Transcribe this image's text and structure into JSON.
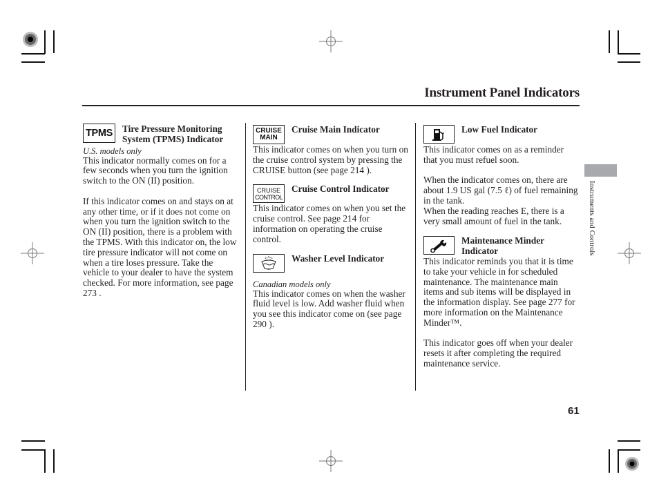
{
  "page": {
    "title": "Instrument Panel Indicators",
    "side_tab_label": "Instruments and Controls",
    "page_number": "61"
  },
  "columns": [
    {
      "sections": [
        {
          "icon": "tpms-icon",
          "icon_text": "TPMS",
          "heading": "Tire Pressure Monitoring System (TPMS) Indicator",
          "note": "U.S. models only",
          "paragraphs": [
            "This indicator normally comes on for a few seconds when you turn the ignition switch to the ON (II) position.",
            "If this indicator comes on and stays on at any other time, or if it does not come on when you turn the ignition switch to the ON (II) position, there is a problem with the TPMS. With this indicator on, the low tire pressure indicator will not come on when a tire loses pressure. Take the vehicle to your dealer to have the system checked. For more information, see page 273 ."
          ]
        }
      ]
    },
    {
      "sections": [
        {
          "icon": "cruise-main-icon",
          "icon_text_line1": "CRUISE",
          "icon_text_line2": "MAIN",
          "heading": "Cruise Main Indicator",
          "paragraphs": [
            "This indicator comes on when you turn on the cruise control system by pressing the CRUISE button (see page 214 )."
          ]
        },
        {
          "icon": "cruise-control-icon",
          "icon_text_line1": "CRUISE",
          "icon_text_line2": "CONTROL",
          "heading": "Cruise Control Indicator",
          "paragraphs": [
            "This indicator comes on when you set the cruise control. See page  214 for information on operating the cruise control."
          ]
        },
        {
          "icon": "washer-fluid-icon",
          "heading": "Washer Level Indicator",
          "note": "Canadian models only",
          "paragraphs": [
            "This indicator comes on when the washer fluid level is low. Add washer fluid when you see this indicator come on (see page 290 )."
          ]
        }
      ]
    },
    {
      "sections": [
        {
          "icon": "fuel-pump-icon",
          "heading": "Low Fuel Indicator",
          "paragraphs": [
            "This indicator comes on as a reminder that you must refuel soon.",
            "When the indicator comes on, there are about 1.9 US gal (7.5 ℓ) of fuel remaining in the tank.\nWhen the reading reaches E, there is a very small amount of fuel in the tank."
          ]
        },
        {
          "icon": "wrench-icon",
          "heading": "Maintenance Minder Indicator",
          "paragraphs": [
            "This indicator reminds you that it is time to take your vehicle in for scheduled maintenance. The maintenance main items and sub items will be displayed in the information display. See page 277 for more information on the Maintenance Minder™.",
            "This indicator goes off when your dealer resets it after completing the required maintenance service."
          ]
        }
      ]
    }
  ],
  "colors": {
    "text": "#231f20",
    "side_tab": "#a7a9ac"
  }
}
